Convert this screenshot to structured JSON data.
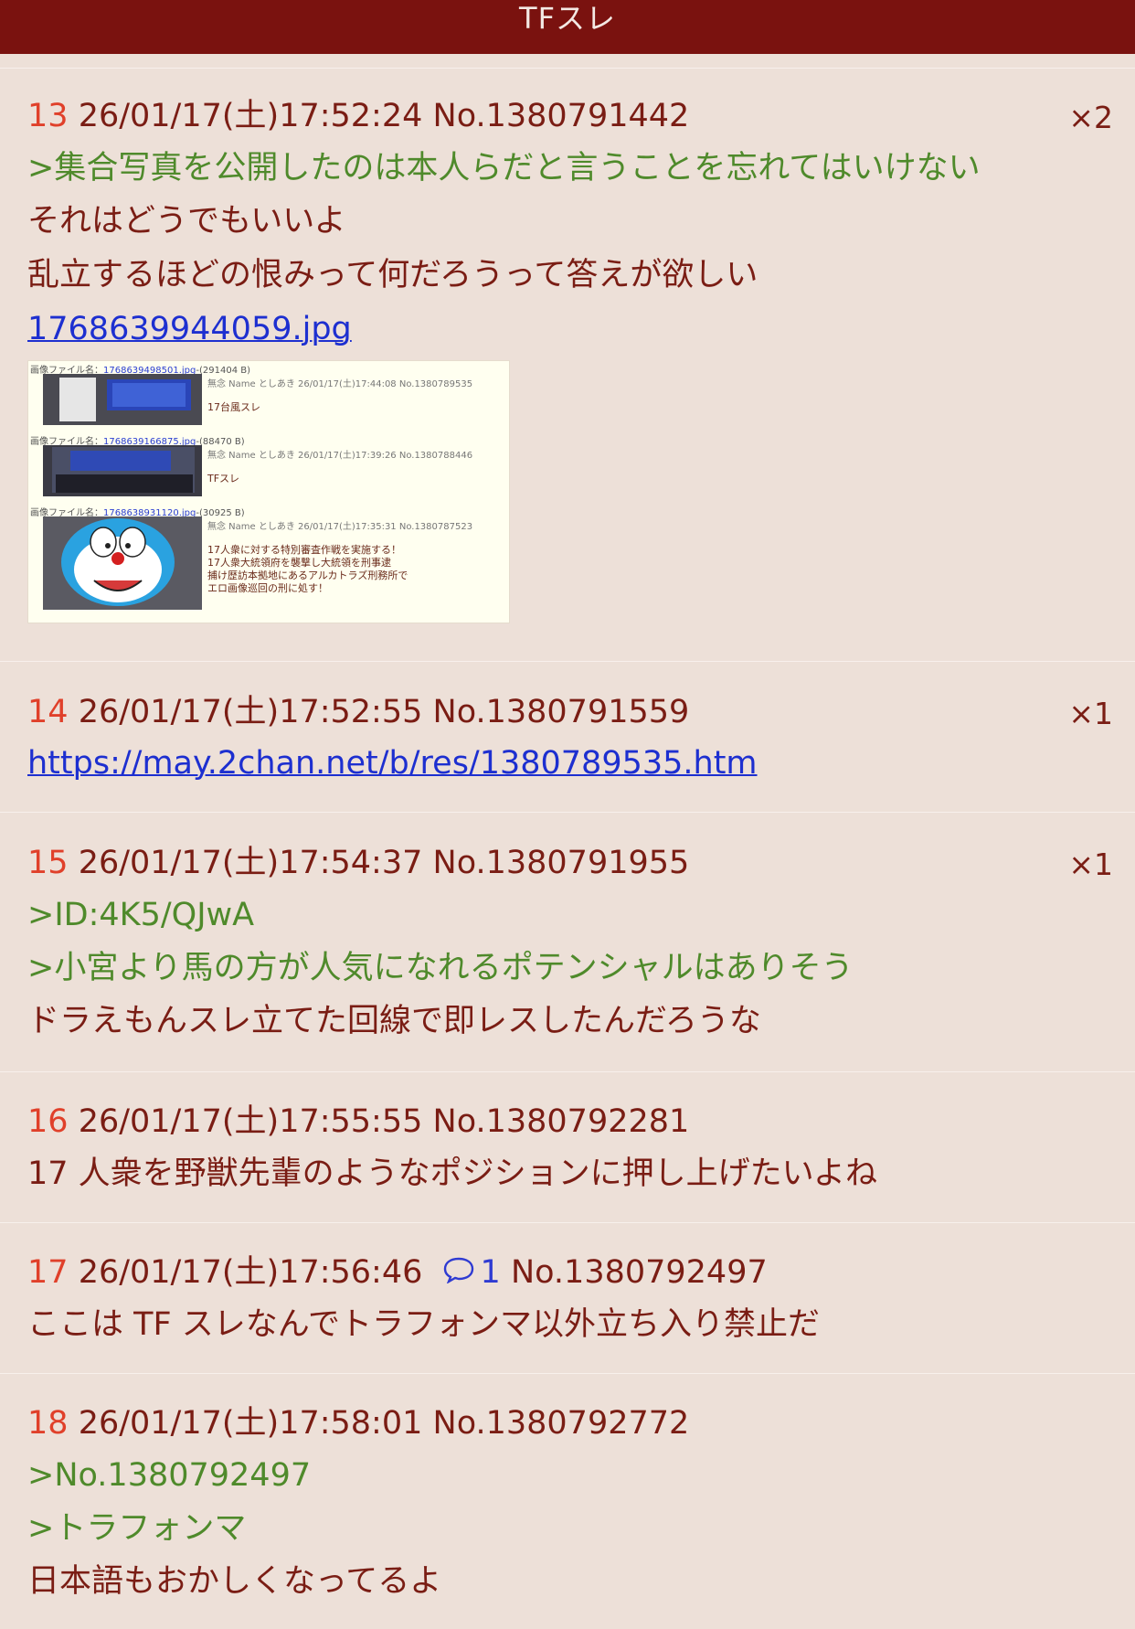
{
  "header": {
    "title": "TFスレ"
  },
  "posts": [
    {
      "num": "13",
      "meta": "26/01/17(土)17:52:24 No.1380791442",
      "count": "×2",
      "lines": [
        ">集合写真を公開したのは本人らだと言うことを忘れてはいけない",
        "それはどうでもいいよ",
        "乱立するほどの恨みって何だろうって答えが欲しい"
      ],
      "file": "1768639944059.jpg"
    },
    {
      "num": "14",
      "meta": "26/01/17(土)17:52:55 No.1380791559",
      "count": "×1",
      "link": "https://may.2chan.net/b/res/1380789535.htm"
    },
    {
      "num": "15",
      "meta": "26/01/17(土)17:54:37 No.1380791955",
      "count": "×1",
      "lines": [
        ">ID:4K5/QJwA",
        ">小宮より馬の方が人気になれるポテンシャルはありそう",
        "ドラえもんスレ立てた回線で即レスしたんだろうな"
      ]
    },
    {
      "num": "16",
      "meta": "26/01/17(土)17:55:55 No.1380792281",
      "lines": [
        "17 人衆を野獣先輩のようなポジションに押し上げたいよね"
      ]
    },
    {
      "num": "17",
      "date": "26/01/17(土)17:56:46",
      "replies": "1",
      "postno": "No.1380792497",
      "lines": [
        "ここは TF スレなんでトラフォンマ以外立ち入り禁止だ"
      ]
    },
    {
      "num": "18",
      "meta": "26/01/17(土)17:58:01 No.1380792772",
      "lines": [
        ">No.1380792497",
        ">トラフォンマ",
        "日本語もおかしくなってるよ"
      ]
    }
  ],
  "thumbnail": {
    "rows": [
      {
        "caption_label": "画像ファイル名：",
        "file": "1768639498501.jpg",
        "size": "-(291404 B)",
        "name": "無念 Name としあき 26/01/17(土)17:44:08 No.1380789535",
        "text": [
          "17台風スレ"
        ]
      },
      {
        "caption_label": "画像ファイル名：",
        "file": "1768639166875.jpg",
        "size": "-(88470 B)",
        "name": "無念 Name としあき 26/01/17(土)17:39:26 No.1380788446",
        "text": [
          "TFスレ"
        ]
      },
      {
        "caption_label": "画像ファイル名：",
        "file": "1768638931120.jpg",
        "size": "-(30925 B)",
        "name": "無念 Name としあき 26/01/17(土)17:35:31 No.1380787523",
        "text": [
          "17人衆に対する特別審査作戦を実施する！",
          "17人衆大統領府を襲撃し大統領を刑事逮",
          "捕け歴訪本拠地にあるアルカトラズ刑務所で",
          "エロ画像巡回の刑に処す！"
        ]
      }
    ]
  },
  "colors": {
    "header_bg": "#7a120f",
    "page_bg": "#ede0d8",
    "quote": "#4f8a2b",
    "text": "#7a1d14",
    "number": "#e0402a",
    "link": "#1d2fd0"
  }
}
